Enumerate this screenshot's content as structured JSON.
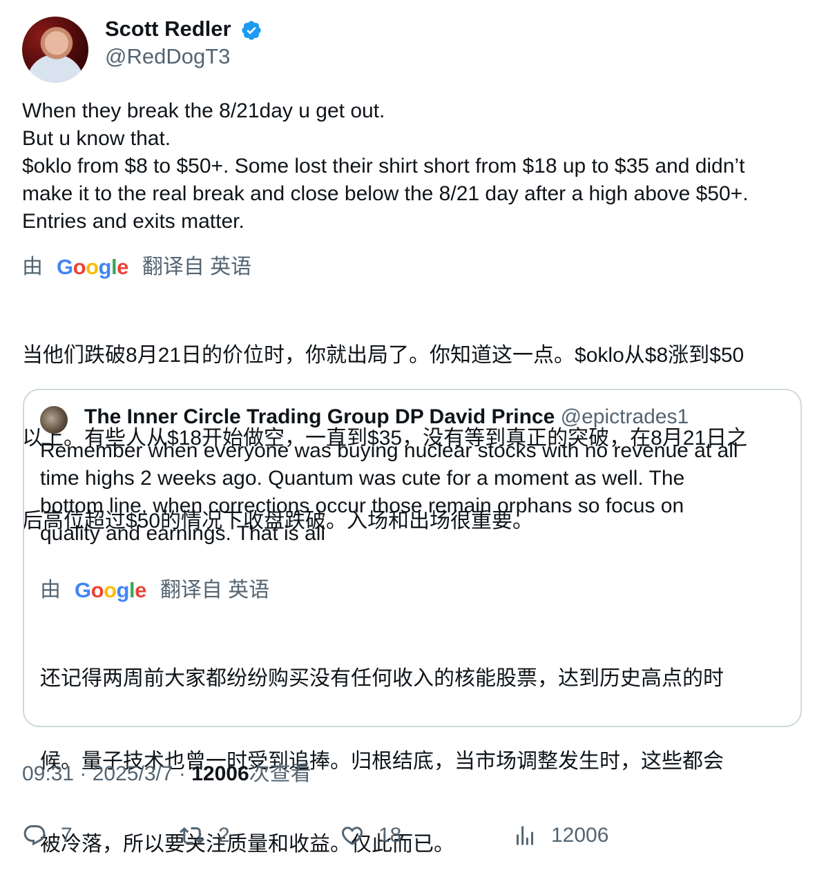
{
  "author": {
    "name": "Scott Redler",
    "handle": "@RedDogT3",
    "verified_color": "#1d9bf0"
  },
  "tweet": {
    "lines": [
      "When they break the 8/21day u get out.",
      "But u know that.",
      "$oklo from $8 to $50+. Some lost their shirt short from $18 up to $35 and didn’t",
      "make it to the real break and close below the 8/21 day after a high above $50+.",
      "Entries and exits matter."
    ],
    "translate_by": "由",
    "translate_from": "翻译自 英语",
    "translated_lines": [
      "当他们跌破8月21日的价位时，你就出局了。你知道这一点。$oklo从$8涨到$50",
      "以上。有些人从$18开始做空，一直到$35，没有等到真正的突破，在8月21日之",
      "后高位超过$50的情况下收盘跌破。入场和出场很重要。"
    ]
  },
  "google_logo": "Google",
  "quote": {
    "name": "The Inner Circle Trading Group DP David Prince",
    "handle": "@epictrades1",
    "lines": [
      "Remember when everyone was buying nuclear stocks with no revenue at all",
      "time highs 2 weeks ago. Quantum was cute for a moment as well. The",
      "bottom line, when corrections occur those remain orphans so focus on",
      "quality and earnings. That is all"
    ],
    "translate_by": "由",
    "translate_from": "翻译自 英语",
    "translated_lines": [
      "还记得两周前大家都纷纷购买没有任何收入的核能股票，达到历史高点的时",
      "候。量子技术也曾一时受到追捧。归根结底，当市场调整发生时，这些都会",
      "被冷落，所以要关注质量和收益。仅此而已。"
    ]
  },
  "meta": {
    "time": "09:31",
    "sep1": " · ",
    "date": "2025/3/7",
    "sep2": " · ",
    "views_count": "12006",
    "views_label": "次查看"
  },
  "actions": {
    "replies": "7",
    "retweets": "2",
    "likes": "18",
    "views": "12006"
  }
}
